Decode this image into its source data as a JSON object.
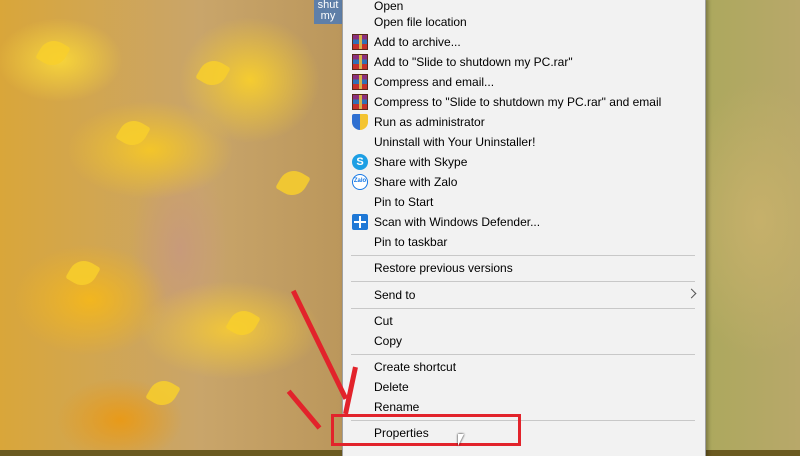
{
  "desktop": {
    "icon_label": "shut my"
  },
  "menu": {
    "items": [
      {
        "label": "Open",
        "icon": ""
      },
      {
        "label": "Open file location",
        "icon": ""
      },
      {
        "label": "Add to archive...",
        "icon": "winrar-icon"
      },
      {
        "label": "Add to \"Slide to shutdown my PC.rar\"",
        "icon": "winrar-icon"
      },
      {
        "label": "Compress and email...",
        "icon": "winrar-icon"
      },
      {
        "label": "Compress to \"Slide to shutdown my PC.rar\" and email",
        "icon": "winrar-icon"
      },
      {
        "label": "Run as administrator",
        "icon": "shield-icon"
      },
      {
        "label": "Uninstall with Your Uninstaller!",
        "icon": ""
      },
      {
        "label": "Share with Skype",
        "icon": "skype-icon"
      },
      {
        "label": "Share with Zalo",
        "icon": "zalo-icon"
      },
      {
        "label": "Pin to Start",
        "icon": ""
      },
      {
        "label": "Scan with Windows Defender...",
        "icon": "defender-icon"
      },
      {
        "label": "Pin to taskbar",
        "icon": ""
      },
      {
        "label": "Restore previous versions",
        "icon": ""
      },
      {
        "label": "Send to",
        "icon": "chevron-right-icon"
      },
      {
        "label": "Cut",
        "icon": ""
      },
      {
        "label": "Copy",
        "icon": ""
      },
      {
        "label": "Create shortcut",
        "icon": ""
      },
      {
        "label": "Delete",
        "icon": ""
      },
      {
        "label": "Rename",
        "icon": ""
      },
      {
        "label": "Properties",
        "icon": ""
      }
    ],
    "icon_text": {
      "skype": "S",
      "zalo": "Zalo"
    }
  },
  "colors": {
    "annotation": "#e2232b",
    "menu_background": "#f2f2f2"
  }
}
